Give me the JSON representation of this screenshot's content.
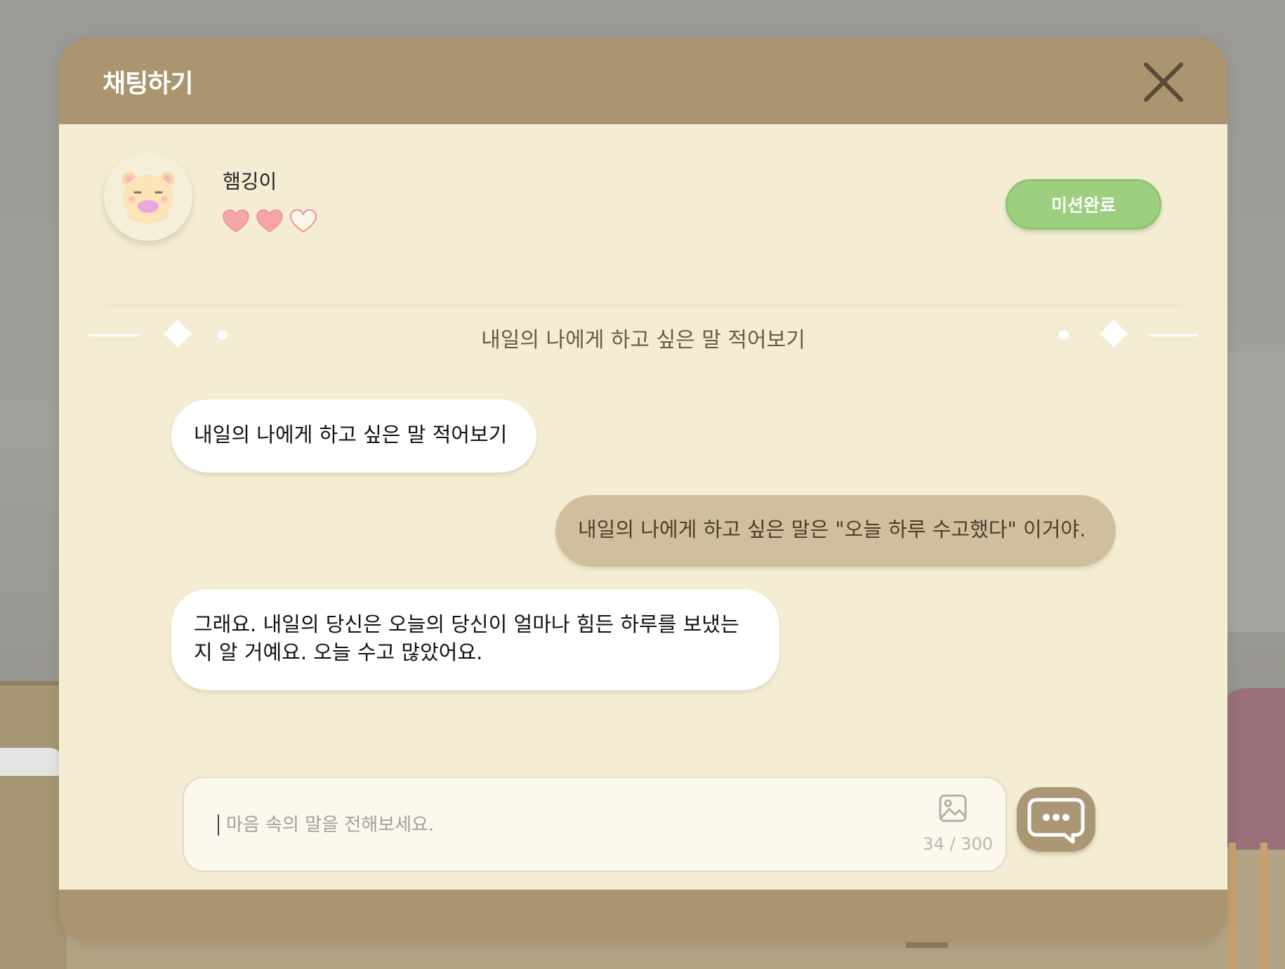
{
  "header": {
    "title": "채팅하기"
  },
  "profile": {
    "name": "햄깅이",
    "hearts_filled": 2,
    "hearts_total": 3
  },
  "mission_button": {
    "label": "미션완료"
  },
  "topic": {
    "text": "내일의 나에게 하고 싶은 말 적어보기"
  },
  "messages": [
    {
      "sender": "bot",
      "text": "내일의 나에게 하고 싶은 말 적어보기"
    },
    {
      "sender": "user",
      "text": "내일의 나에게 하고 싶은 말은 \"오늘 하루 수고했다\" 이거야."
    },
    {
      "sender": "bot",
      "text": "그래요. 내일의 당신은 오늘의 당신이 얼마나 힘든 하루를 보냈는지 알 거예요. 오늘 수고 많았어요."
    }
  ],
  "composer": {
    "placeholder": "마음 속의 말을 전해보세요.",
    "value": "",
    "counter": "34 / 300"
  },
  "icons": {
    "close": "close-icon",
    "image": "image-icon",
    "send": "chat-bubble-icon",
    "heart_filled": "heart-filled-icon",
    "heart_empty": "heart-outline-icon"
  },
  "colors": {
    "frame": "#aa9570",
    "body": "#f4edd4",
    "mission_green": "#9ccf7f",
    "user_bubble": "#d0bf9f",
    "heart": "#f5a6a6"
  }
}
